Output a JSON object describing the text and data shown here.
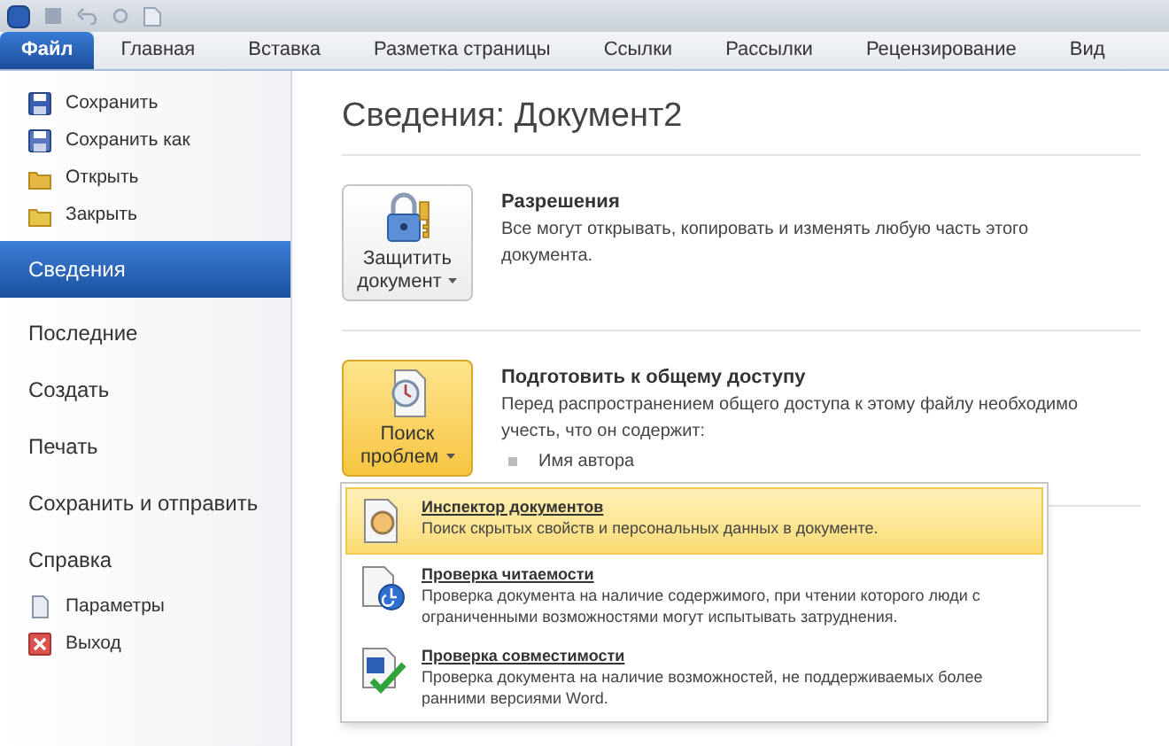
{
  "ribbon_tabs": [
    {
      "label": "Файл",
      "selected": true
    },
    {
      "label": "Главная",
      "selected": false
    },
    {
      "label": "Вставка",
      "selected": false
    },
    {
      "label": "Разметка страницы",
      "selected": false
    },
    {
      "label": "Ссылки",
      "selected": false
    },
    {
      "label": "Рассылки",
      "selected": false
    },
    {
      "label": "Рецензирование",
      "selected": false
    },
    {
      "label": "Вид",
      "selected": false
    }
  ],
  "sidebar": {
    "items": [
      {
        "kind": "command",
        "label": "Сохранить",
        "selected": false
      },
      {
        "kind": "command",
        "label": "Сохранить как",
        "selected": false
      },
      {
        "kind": "command",
        "label": "Открыть",
        "selected": false
      },
      {
        "kind": "command",
        "label": "Закрыть",
        "selected": false
      },
      {
        "kind": "page",
        "label": "Сведения",
        "selected": true
      },
      {
        "kind": "page",
        "label": "Последние",
        "selected": false
      },
      {
        "kind": "page",
        "label": "Создать",
        "selected": false
      },
      {
        "kind": "page",
        "label": "Печать",
        "selected": false
      },
      {
        "kind": "page",
        "label": "Сохранить и отправить",
        "selected": false
      },
      {
        "kind": "page",
        "label": "Справка",
        "selected": false
      },
      {
        "kind": "command",
        "label": "Параметры",
        "selected": false
      },
      {
        "kind": "command",
        "label": "Выход",
        "selected": false
      }
    ]
  },
  "page_title": "Сведения: Документ2",
  "sections": [
    {
      "button": "Защитить документ",
      "open": false,
      "heading": "Разрешения",
      "text": "Все могут открывать, копировать и изменять любую часть этого документа."
    },
    {
      "button": "Поиск проблем",
      "open": true,
      "heading": "Подготовить к общему доступу",
      "text": "Перед распространением общего доступа к этому файлу необходимо учесть, что он содержит:",
      "bullets": [
        "Имя автора"
      ]
    }
  ],
  "menu": [
    {
      "title": "Инспектор документов",
      "text": "Поиск скрытых свойств и персональных данных в документе.",
      "selected": true
    },
    {
      "title": "Проверка читаемости",
      "text": "Проверка документа на наличие содержимого, при чтении которого люди с ограниченными возможностями могут испытывать затруднения.",
      "selected": false
    },
    {
      "title": "Проверка совместимости",
      "text": "Проверка документа на наличие возможностей, не поддерживаемых более ранними версиями Word.",
      "selected": false
    }
  ]
}
